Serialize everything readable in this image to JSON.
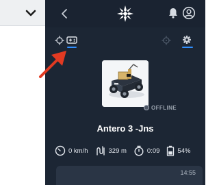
{
  "robot": {
    "name": "Antero 3 -Jns",
    "status": "OFFLINE"
  },
  "stats": {
    "speed": "0 km/h",
    "distance": "329 m",
    "time": "0:09",
    "battery": "54%"
  },
  "chat": {
    "timestamp": "14:55"
  },
  "colors": {
    "panel_bg": "#1c2634",
    "accent": "#2f8fff",
    "annotation_arrow": "#e23a22"
  },
  "icons": {
    "collapse": "chevron-down-icon",
    "back": "chevron-left-icon",
    "logo": "snowflake-star-icon",
    "notifications": "bell-icon",
    "profile": "user-circle-icon",
    "tab_location": "crosshair-icon",
    "tab_controller": "gamepad-icon",
    "tab_map": "target-icon",
    "tab_settings": "gear-icon"
  }
}
